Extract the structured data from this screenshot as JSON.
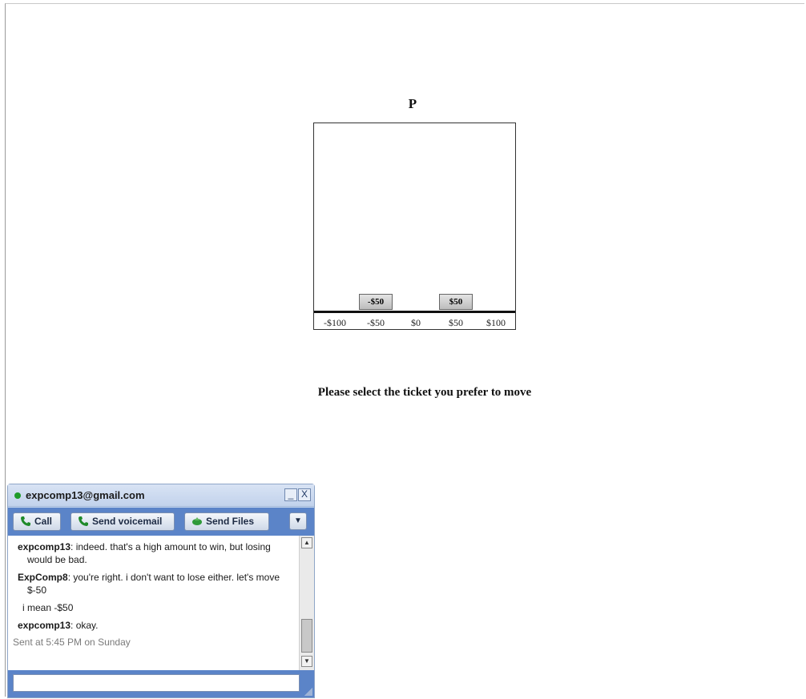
{
  "panel": {
    "title": "P",
    "axis_labels": [
      "-$100",
      "-$50",
      "$0",
      "$50",
      "$100"
    ],
    "tickets": [
      {
        "label": "-$50"
      },
      {
        "label": "$50"
      }
    ],
    "prompt": "Please select the ticket you prefer to move"
  },
  "chat": {
    "email": "expcomp13@gmail.com",
    "status_color": "#1f9b2a",
    "window_buttons": {
      "minimize": "_",
      "close": "X"
    },
    "toolbar": {
      "call_label": "Call",
      "voicemail_label": "Send voicemail",
      "files_label": "Send Files",
      "more_icon": "chevron-down-icon"
    },
    "messages": [
      {
        "sender": "expcomp13",
        "text": ": indeed. that's a high amount to win, but losing would be bad."
      },
      {
        "sender": "ExpComp8",
        "text": ": you're right. i don't want to lose either. let's move $-50"
      },
      {
        "continuation": "i mean -$50"
      },
      {
        "sender": "expcomp13",
        "text": ": okay."
      }
    ],
    "sent_note": "Sent at 5:45 PM on Sunday",
    "input_value": ""
  }
}
